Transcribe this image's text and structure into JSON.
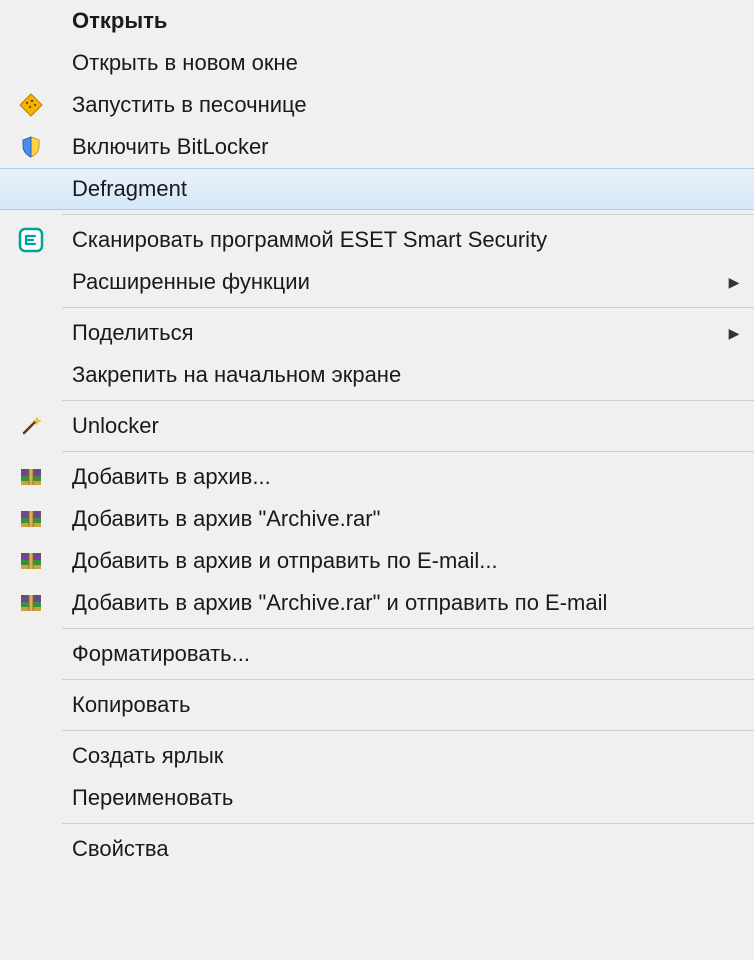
{
  "menu": {
    "items": [
      {
        "id": "open",
        "label": "Открыть",
        "bold": true
      },
      {
        "id": "open-new-window",
        "label": "Открыть в новом окне"
      },
      {
        "id": "run-sandbox",
        "label": "Запустить в песочнице",
        "icon": "sandbox"
      },
      {
        "id": "bitlocker",
        "label": "Включить BitLocker",
        "icon": "shield"
      },
      {
        "id": "defragment",
        "label": "Defragment",
        "highlighted": true
      },
      {
        "separator": true
      },
      {
        "id": "eset-scan",
        "label": "Сканировать программой ESET Smart Security",
        "icon": "eset"
      },
      {
        "id": "advanced",
        "label": "Расширенные функции",
        "submenu": true
      },
      {
        "separator": true
      },
      {
        "id": "share",
        "label": "Поделиться",
        "submenu": true
      },
      {
        "id": "pin-start",
        "label": "Закрепить на начальном экране"
      },
      {
        "separator": true
      },
      {
        "id": "unlocker",
        "label": "Unlocker",
        "icon": "wand"
      },
      {
        "separator": true
      },
      {
        "id": "add-archive",
        "label": "Добавить в архив...",
        "icon": "winrar"
      },
      {
        "id": "add-archive-rar",
        "label": "Добавить в архив \"Archive.rar\"",
        "icon": "winrar"
      },
      {
        "id": "archive-email",
        "label": "Добавить в архив и отправить по E-mail...",
        "icon": "winrar"
      },
      {
        "id": "archive-rar-email",
        "label": "Добавить в архив \"Archive.rar\" и отправить по E-mail",
        "icon": "winrar"
      },
      {
        "separator": true
      },
      {
        "id": "format",
        "label": "Форматировать..."
      },
      {
        "separator": true
      },
      {
        "id": "copy",
        "label": "Копировать"
      },
      {
        "separator": true
      },
      {
        "id": "shortcut",
        "label": "Создать ярлык"
      },
      {
        "id": "rename",
        "label": "Переименовать"
      },
      {
        "separator": true
      },
      {
        "id": "properties",
        "label": "Свойства"
      }
    ]
  }
}
